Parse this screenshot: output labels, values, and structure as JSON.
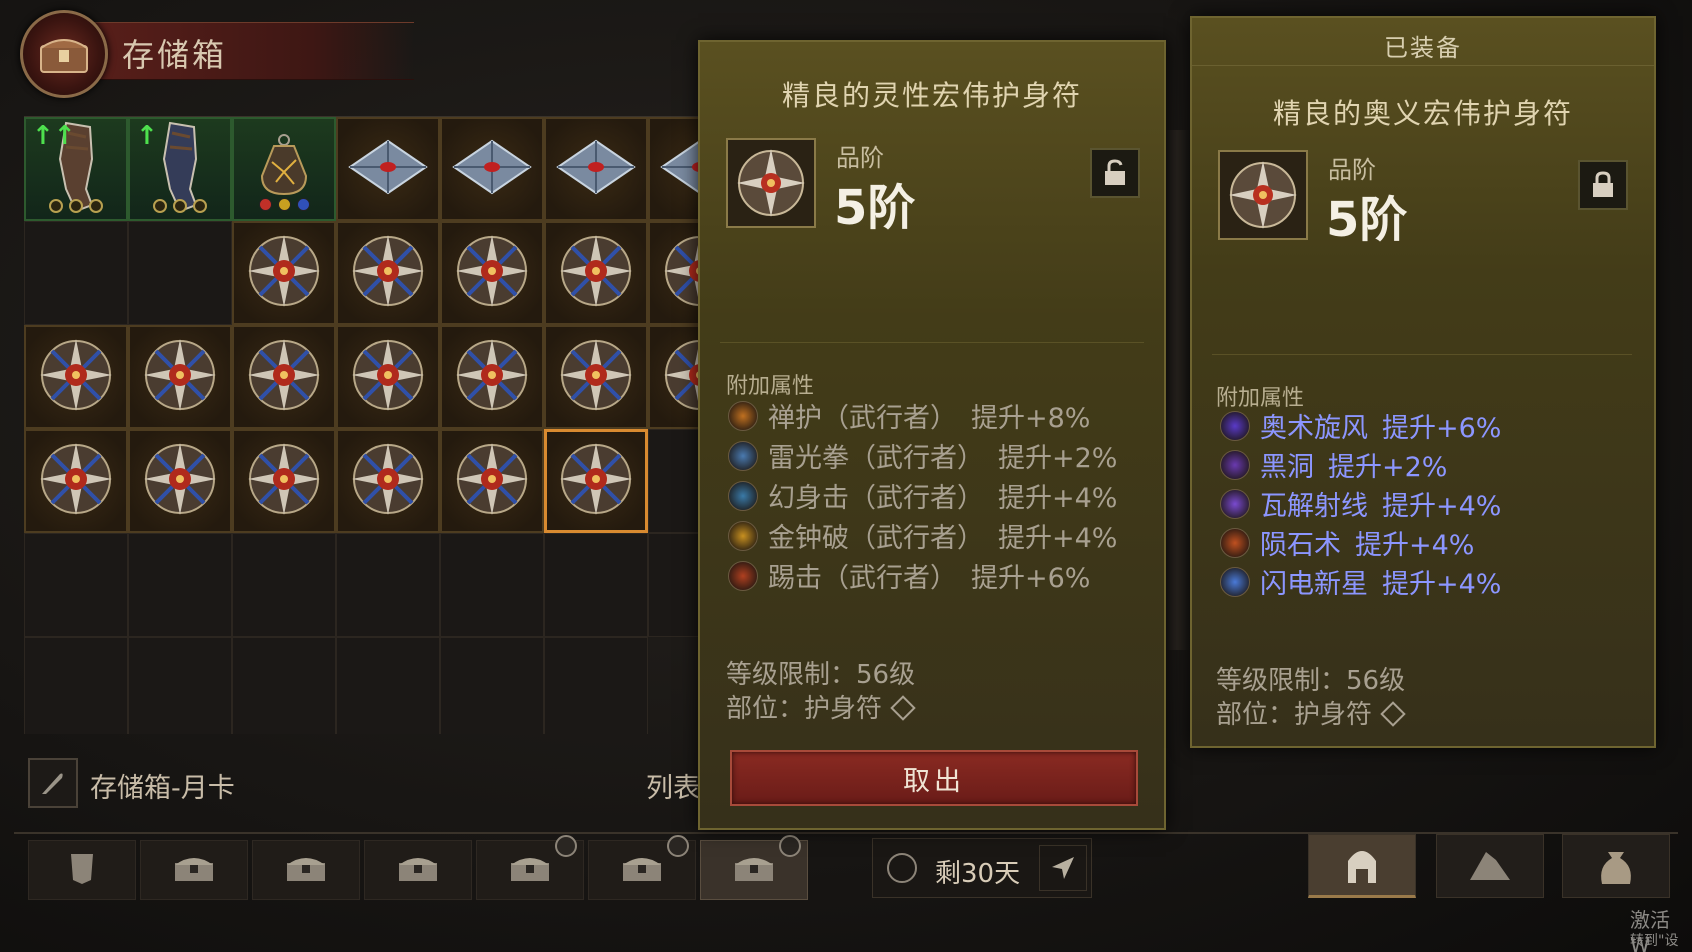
{
  "stash": {
    "title": "存储箱",
    "month_card_label": "存储箱-月卡",
    "list_label": "列表"
  },
  "grid": {
    "slots": [
      {
        "kind": "gauntlet",
        "style": "green",
        "upgrade": "↑↑",
        "sockets": 3
      },
      {
        "kind": "gauntlet-blue",
        "style": "green",
        "upgrade": "↑",
        "sockets": 3
      },
      {
        "kind": "amulet-bag",
        "style": "green",
        "gems": [
          "#c03028",
          "#c8a020",
          "#3050b8"
        ]
      },
      {
        "kind": "diamond",
        "style": "filled"
      },
      {
        "kind": "diamond",
        "style": "filled"
      },
      {
        "kind": "diamond",
        "style": "filled"
      },
      {
        "kind": "diamond",
        "style": "filled"
      },
      {
        "kind": "",
        "style": "covered"
      },
      {
        "kind": "",
        "style": "covered"
      },
      {
        "kind": "charm",
        "style": "filled"
      },
      {
        "kind": "charm",
        "style": "filled"
      },
      {
        "kind": "charm",
        "style": "filled"
      },
      {
        "kind": "charm",
        "style": "filled"
      },
      {
        "kind": "charm",
        "style": "filled"
      },
      {
        "kind": "charm",
        "style": "filled"
      },
      {
        "kind": "charm",
        "style": "filled"
      },
      {
        "kind": "charm",
        "style": "filled"
      },
      {
        "kind": "charm",
        "style": "filled"
      },
      {
        "kind": "charm",
        "style": "filled"
      },
      {
        "kind": "charm",
        "style": "filled"
      },
      {
        "kind": "charm",
        "style": "filled"
      },
      {
        "kind": "charm",
        "style": "filled"
      },
      {
        "kind": "charm",
        "style": "filled"
      },
      {
        "kind": "charm",
        "style": "filled"
      },
      {
        "kind": "charm",
        "style": "filled"
      },
      {
        "kind": "charm",
        "style": "filled"
      },
      {
        "kind": "charm",
        "style": "selected"
      },
      {
        "kind": "",
        "style": "empty"
      },
      {
        "kind": "",
        "style": "empty"
      },
      {
        "kind": "",
        "style": "empty"
      },
      {
        "kind": "",
        "style": "empty"
      },
      {
        "kind": "",
        "style": "empty"
      },
      {
        "kind": "",
        "style": "empty"
      },
      {
        "kind": "",
        "style": "empty"
      },
      {
        "kind": "",
        "style": "empty"
      },
      {
        "kind": "",
        "style": "empty"
      },
      {
        "kind": "",
        "style": "empty"
      },
      {
        "kind": "",
        "style": "empty"
      },
      {
        "kind": "",
        "style": "empty"
      },
      {
        "kind": "",
        "style": "empty"
      },
      {
        "kind": "",
        "style": "empty"
      }
    ]
  },
  "tabs": {
    "count": 7,
    "active_index": 6,
    "timed_indices": [
      4,
      5,
      6
    ],
    "remaining_label": "剩30天"
  },
  "compare_item": {
    "name": "精良的灵性宏伟护身符",
    "tier_label": "品阶",
    "tier_value": "5阶",
    "attrs_title": "附加属性",
    "attrs": [
      {
        "icon": "shield-monk-icon",
        "color": "#c07020",
        "name": "禅护（武行者）",
        "value": "提升+8%"
      },
      {
        "icon": "lightning-fist-icon",
        "color": "#4a7ab0",
        "name": "雷光拳（武行者）",
        "value": "提升+2%"
      },
      {
        "icon": "phantom-strike-icon",
        "color": "#3a7aa8",
        "name": "幻身击（武行者）",
        "value": "提升+4%"
      },
      {
        "icon": "golden-bell-icon",
        "color": "#c89020",
        "name": "金钟破（武行者）",
        "value": "提升+4%"
      },
      {
        "icon": "kick-icon",
        "color": "#b04020",
        "name": "踢击（武行者）",
        "value": "提升+6%"
      }
    ],
    "level_req": "等级限制：56级",
    "slot_label": "部位：护身符",
    "take_button": "取出"
  },
  "equipped_item": {
    "header": "已装备",
    "name": "精良的奥义宏伟护身符",
    "tier_label": "品阶",
    "tier_value": "5阶",
    "attrs_title": "附加属性",
    "attrs": [
      {
        "icon": "arcane-vortex-icon",
        "color": "#5a3ac8",
        "name": "奥术旋风",
        "value": "提升+6%"
      },
      {
        "icon": "black-hole-icon",
        "color": "#6a3ab0",
        "name": "黑洞",
        "value": "提升+2%"
      },
      {
        "icon": "disintegrate-icon",
        "color": "#7a4ad0",
        "name": "瓦解射线",
        "value": "提升+4%"
      },
      {
        "icon": "meteor-icon",
        "color": "#c05020",
        "name": "陨石术",
        "value": "提升+4%"
      },
      {
        "icon": "lightning-nova-icon",
        "color": "#4a7ad8",
        "name": "闪电新星",
        "value": "提升+4%"
      }
    ],
    "level_req": "等级限制：56级",
    "slot_label": "部位：护身符"
  },
  "watermark": {
    "line1": "激活 W",
    "line2": "转到\"设置"
  }
}
